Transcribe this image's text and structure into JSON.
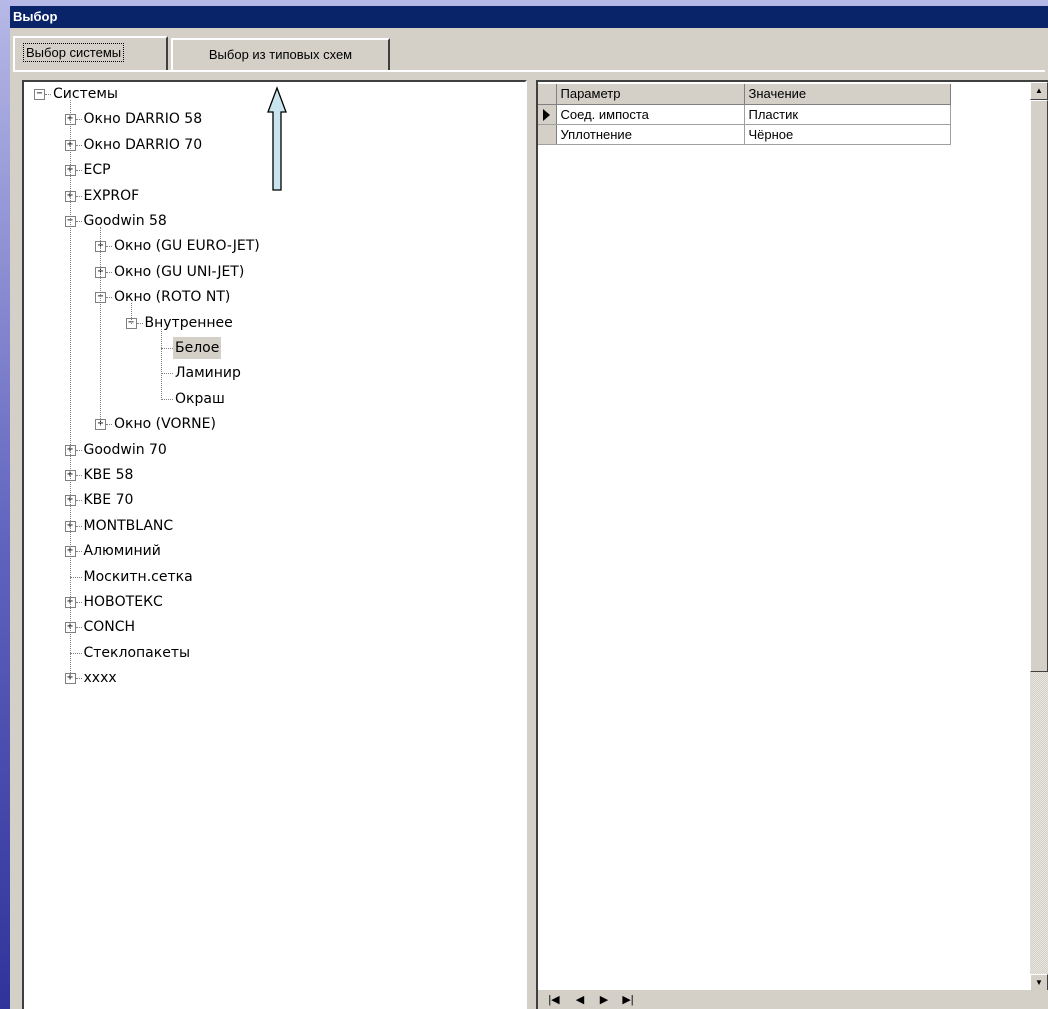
{
  "window": {
    "title": "Выбор"
  },
  "tabs": [
    {
      "label": "Выбор системы",
      "active": true
    },
    {
      "label": "Выбор из типовых схем",
      "active": false
    }
  ],
  "tree": {
    "nodes": [
      {
        "label": "Системы",
        "expanded": true,
        "level": 0
      },
      {
        "label": "Окно DARRIO 58",
        "expanded": false,
        "level": 1
      },
      {
        "label": "Окно DARRIO 70",
        "expanded": false,
        "level": 1
      },
      {
        "label": "ECP",
        "expanded": false,
        "level": 1
      },
      {
        "label": "EXPROF",
        "expanded": false,
        "level": 1
      },
      {
        "label": "Goodwin 58",
        "expanded": true,
        "level": 1
      },
      {
        "label": "Окно (GU EURO-JET)",
        "expanded": false,
        "level": 2
      },
      {
        "label": "Окно (GU UNI-JET)",
        "expanded": false,
        "level": 2
      },
      {
        "label": "Окно (ROTO NT)",
        "expanded": true,
        "level": 2
      },
      {
        "label": "Внутреннее",
        "expanded": true,
        "level": 3
      },
      {
        "label": "Белое",
        "level": 4,
        "selected": true
      },
      {
        "label": "Ламинир",
        "level": 4
      },
      {
        "label": "Окраш",
        "level": 4
      },
      {
        "label": "Окно (VORNE)",
        "expanded": false,
        "level": 2
      },
      {
        "label": "Goodwin 70",
        "expanded": false,
        "level": 1
      },
      {
        "label": "KBE 58",
        "expanded": false,
        "level": 1
      },
      {
        "label": "KBE 70",
        "expanded": false,
        "level": 1
      },
      {
        "label": "MONTBLANC",
        "expanded": false,
        "level": 1
      },
      {
        "label": "Алюминий",
        "expanded": false,
        "level": 1
      },
      {
        "label": "Москитн.сетка",
        "level": 1
      },
      {
        "label": "НОВОТЕКС",
        "expanded": false,
        "level": 1
      },
      {
        "label": "CONCH",
        "expanded": false,
        "level": 1
      },
      {
        "label": "Стеклопакеты",
        "level": 1
      },
      {
        "label": "xxxx",
        "expanded": false,
        "level": 1
      }
    ]
  },
  "grid": {
    "columns": [
      "Параметр",
      "Значение"
    ],
    "rows": [
      {
        "param": "Соед. импоста",
        "value": "Пластик",
        "current": true
      },
      {
        "param": "Уплотнение",
        "value": "Чёрное",
        "current": false
      }
    ]
  },
  "navigator": {
    "buttons": [
      "first-icon",
      "prior-icon",
      "next-icon",
      "last-icon"
    ]
  },
  "colors": {
    "titlebar": "#0a246a",
    "face": "#d4d0c8",
    "arrow_fill": "#c8e4ee"
  }
}
